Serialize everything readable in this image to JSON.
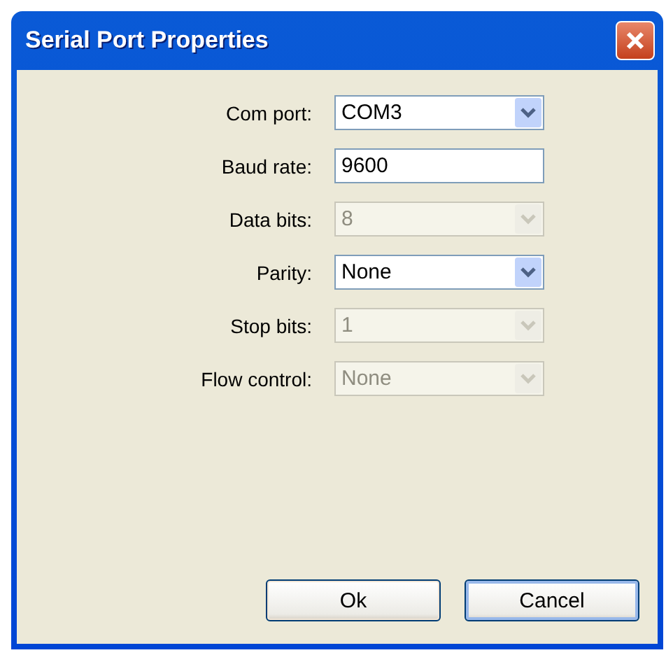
{
  "window": {
    "title": "Serial Port Properties"
  },
  "fields": [
    {
      "label": "Com port:",
      "kind": "combo",
      "value": "COM3",
      "disabled": false
    },
    {
      "label": "Baud rate:",
      "kind": "text",
      "value": "9600",
      "disabled": false
    },
    {
      "label": "Data bits:",
      "kind": "combo",
      "value": "8",
      "disabled": true
    },
    {
      "label": "Parity:",
      "kind": "combo",
      "value": "None",
      "disabled": false
    },
    {
      "label": "Stop bits:",
      "kind": "combo",
      "value": "1",
      "disabled": true
    },
    {
      "label": "Flow control:",
      "kind": "combo",
      "value": "None",
      "disabled": true
    }
  ],
  "buttons": [
    {
      "label": "Ok",
      "selected": false
    },
    {
      "label": "Cancel",
      "selected": true
    }
  ]
}
